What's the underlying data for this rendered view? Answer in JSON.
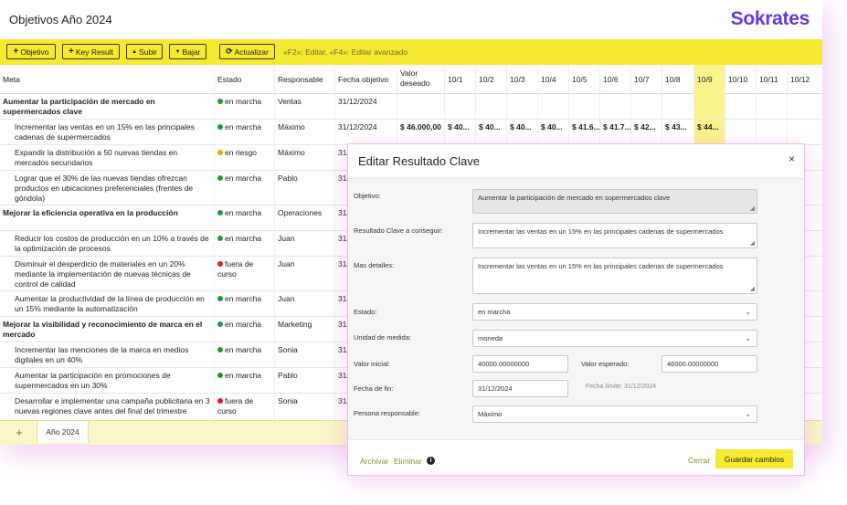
{
  "app": {
    "title": "Objetivos Año 2024",
    "brand": "Sokrates"
  },
  "toolbar": {
    "objetivo": "Objetivo",
    "key_result": "Key Result",
    "subir": "Subir",
    "bajar": "Bajar",
    "actualizar": "Actualizar",
    "hint": "«F2»: Editar, «F4»: Editar avanzado"
  },
  "grid": {
    "headers": {
      "meta": "Meta",
      "estado": "Estado",
      "responsable": "Responsable",
      "fecha": "Fecha objetivo",
      "valor": "Valor deseado"
    },
    "dates": [
      "10/1",
      "10/2",
      "10/3",
      "10/4",
      "10/5",
      "10/6",
      "10/7",
      "10/8",
      "10/9",
      "10/10",
      "10/11",
      "10/12"
    ],
    "rows": [
      {
        "meta": "Aumentar la participación de mercado en supermercados clave",
        "estado": "en marcha",
        "responsable": "Ventas",
        "fecha": "31/12/2024",
        "valor": "",
        "vals": []
      },
      {
        "meta": "Incrementar las ventas en un 15% en las principales cadenas de supermercados",
        "estado": "en marcha",
        "responsable": "Máximo",
        "fecha": "31/12/2024",
        "valor": "$ 46.000,00",
        "vals": [
          "$ 40...",
          "$ 40...",
          "$ 40...",
          "$ 40...",
          "$ 41.6...",
          "$ 41.7...",
          "$ 42...",
          "$ 43...",
          "$ 44..."
        ]
      },
      {
        "meta": "Expandir la distribución a 50 nuevas tiendas en mercados secundarios",
        "estado": "en riesgo",
        "responsable": "Máximo",
        "fecha": "31/",
        "valor": "",
        "vals": []
      },
      {
        "meta": "Lograr que el 30% de las nuevas tiendas ofrezcan productos en ubicaciones preferenciales (frentes de góndola)",
        "estado": "en marcha",
        "responsable": "Pablo",
        "fecha": "31/",
        "valor": "",
        "vals": []
      },
      {
        "meta": "Mejorar la eficiencia operativa en la producción",
        "estado": "en marcha",
        "responsable": "Operaciones",
        "fecha": "31/",
        "valor": "",
        "vals": []
      },
      {
        "meta": "Reducir los costos de producción en un 10% a través de la optimización de procesos",
        "estado": "en marcha",
        "responsable": "Juan",
        "fecha": "31/",
        "valor": "",
        "vals": []
      },
      {
        "meta": "Disminuir el desperdicio de materiales en un 20% mediante la implementación de nuevas técnicas de control de calidad",
        "estado": "fuera de curso",
        "responsable": "Juan",
        "fecha": "31/",
        "valor": "",
        "vals": []
      },
      {
        "meta": "Aumentar la productividad de la línea de producción en un 15% mediante la automatización",
        "estado": "en marcha",
        "responsable": "Juan",
        "fecha": "31/",
        "valor": "",
        "vals": []
      },
      {
        "meta": "Mejorar la visibilidad y reconocimiento de marca en el mercado",
        "estado": "en marcha",
        "responsable": "Marketing",
        "fecha": "31/",
        "valor": "",
        "vals": []
      },
      {
        "meta": "Incrementar las menciones de la marca en medios digitales en un 40%",
        "estado": "en marcha",
        "responsable": "Sonia",
        "fecha": "31/",
        "valor": "",
        "vals": []
      },
      {
        "meta": "Aumentar la participación en promociones de supermercados en un 30%",
        "estado": "en marcha",
        "responsable": "Pablo",
        "fecha": "31/",
        "valor": "",
        "vals": []
      },
      {
        "meta": "Desarrollar e implementar una campaña publicitaria en 3 nuevas regiones clave antes del final del trimestre",
        "estado": "fuera de curso",
        "responsable": "Sonia",
        "fecha": "31/",
        "valor": "",
        "vals": []
      }
    ]
  },
  "status_colors": {
    "en marcha": "#1f9d2b",
    "en riesgo": "#f5a300",
    "fuera de curso": "#e51a1a"
  },
  "tabs": {
    "add": "+",
    "sheet": "Año 2024"
  },
  "modal": {
    "title": "Editar Resultado Clave",
    "close": "×",
    "labels": {
      "objetivo": "Objetivo:",
      "resultado": "Resultado Clave a conseguir:",
      "detalles": "Mas detalles:",
      "estado": "Estado:",
      "unidad": "Unidad de medida:",
      "valor_inicial": "Valor inicial:",
      "valor_esperado": "Valor esperado:",
      "fecha_fin": "Fecha de fin:",
      "persona": "Persona responsable:"
    },
    "values": {
      "objetivo": "Aumentar la participación de mercado en supermercados clave",
      "resultado": "Incrementar las ventas en un 15% en las principales cadenas de supermercados",
      "detalles": "Incrementar las ventas en un 15% en las principales cadenas de supermercados",
      "estado": "en marcha",
      "unidad": "moneda",
      "valor_inicial": "40000.00000000",
      "valor_esperado": "46000.00000000",
      "fecha_fin": "31/12/2024",
      "fecha_limite": "Fecha límite: 31/12/2024",
      "persona": "Máximo"
    },
    "footer": {
      "archivar": "Archivar",
      "eliminar": "Eliminar",
      "info": "i",
      "cerrar": "Cerrar",
      "guardar": "Guardar cambios"
    }
  }
}
